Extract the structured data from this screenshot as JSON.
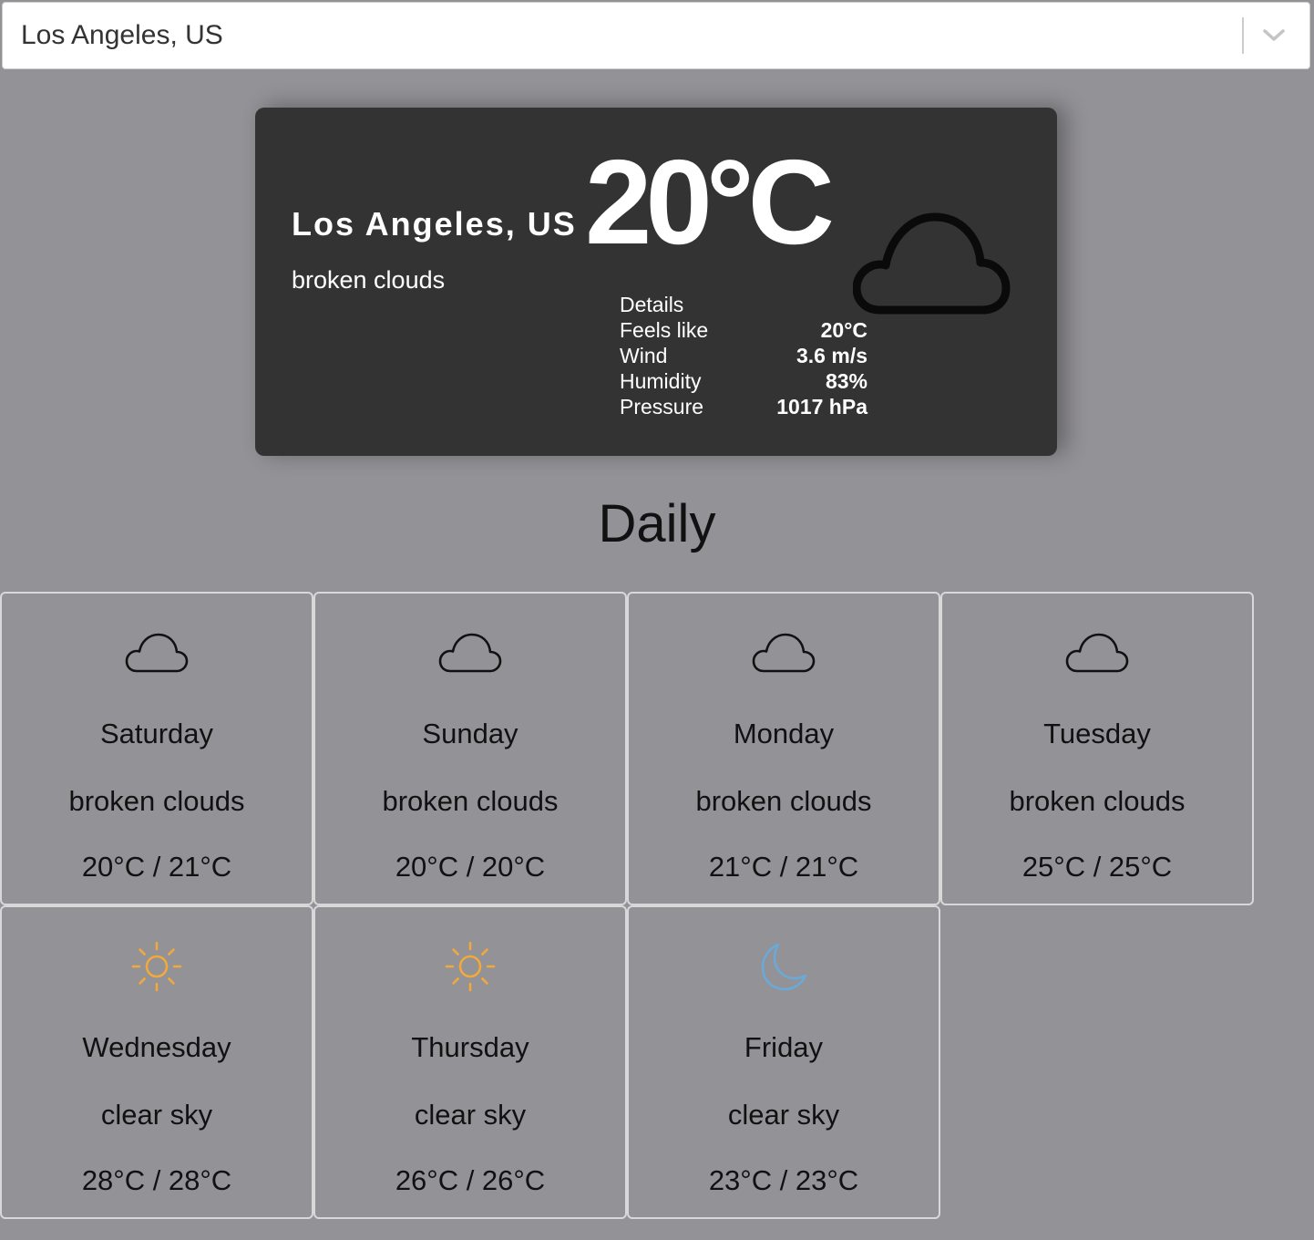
{
  "city_select": {
    "value": "Los Angeles, US",
    "chevron_icon": "chevron-down-icon"
  },
  "current": {
    "city": "Los Angeles, US",
    "description": "broken clouds",
    "temperature": "20°C",
    "icon": "cloud-icon",
    "details_heading": "Details",
    "details": [
      {
        "label": "Feels like",
        "value": "20°C"
      },
      {
        "label": "Wind",
        "value": "3.6 m/s"
      },
      {
        "label": "Humidity",
        "value": "83%"
      },
      {
        "label": "Pressure",
        "value": "1017 hPa"
      }
    ]
  },
  "daily": {
    "title": "Daily",
    "days": [
      {
        "day": "Saturday",
        "condition": "broken clouds",
        "range": "20°C / 21°C",
        "icon": "cloud-icon"
      },
      {
        "day": "Sunday",
        "condition": "broken clouds",
        "range": "20°C / 20°C",
        "icon": "cloud-icon"
      },
      {
        "day": "Monday",
        "condition": "broken clouds",
        "range": "21°C / 21°C",
        "icon": "cloud-icon"
      },
      {
        "day": "Tuesday",
        "condition": "broken clouds",
        "range": "25°C / 25°C",
        "icon": "cloud-icon"
      },
      {
        "day": "Wednesday",
        "condition": "clear sky",
        "range": "28°C / 28°C",
        "icon": "sun-icon"
      },
      {
        "day": "Thursday",
        "condition": "clear sky",
        "range": "26°C / 26°C",
        "icon": "sun-icon"
      },
      {
        "day": "Friday",
        "condition": "clear sky",
        "range": "23°C / 23°C",
        "icon": "moon-icon"
      }
    ]
  },
  "colors": {
    "background": "#939296",
    "card": "#333333",
    "sun": "#f0a93a",
    "moon": "#6aaad8"
  }
}
